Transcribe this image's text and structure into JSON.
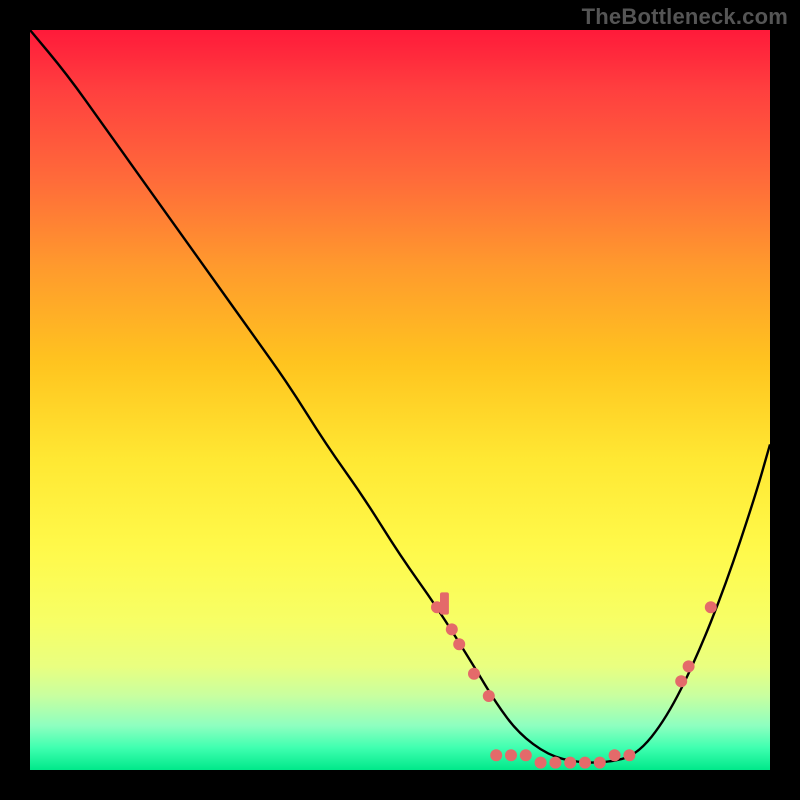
{
  "watermark": "TheBottleneck.com",
  "chart_data": {
    "type": "line",
    "title": "",
    "xlabel": "",
    "ylabel": "",
    "xlim": [
      0,
      100
    ],
    "ylim": [
      0,
      100
    ],
    "series": [
      {
        "name": "curve",
        "x": [
          0,
          5,
          10,
          15,
          20,
          25,
          30,
          35,
          40,
          45,
          50,
          55,
          60,
          63,
          66,
          70,
          74,
          78,
          82,
          86,
          90,
          94,
          98,
          100
        ],
        "y": [
          100,
          94,
          87,
          80,
          73,
          66,
          59,
          52,
          44,
          37,
          29,
          22,
          14,
          9,
          5,
          2,
          1,
          1,
          2,
          7,
          15,
          25,
          37,
          44
        ]
      }
    ],
    "points_on_curve": [
      {
        "x": 55,
        "y": 22
      },
      {
        "x": 57,
        "y": 19
      },
      {
        "x": 58,
        "y": 17
      },
      {
        "x": 60,
        "y": 13
      },
      {
        "x": 62,
        "y": 10
      },
      {
        "x": 63,
        "y": 2
      },
      {
        "x": 65,
        "y": 2
      },
      {
        "x": 67,
        "y": 2
      },
      {
        "x": 69,
        "y": 1
      },
      {
        "x": 71,
        "y": 1
      },
      {
        "x": 73,
        "y": 1
      },
      {
        "x": 75,
        "y": 1
      },
      {
        "x": 77,
        "y": 1
      },
      {
        "x": 79,
        "y": 2
      },
      {
        "x": 81,
        "y": 2
      },
      {
        "x": 88,
        "y": 12
      },
      {
        "x": 89,
        "y": 14
      },
      {
        "x": 92,
        "y": 22
      }
    ],
    "cluster_bar": {
      "x": 56,
      "y": 21,
      "w": 1.2,
      "h": 3
    }
  }
}
